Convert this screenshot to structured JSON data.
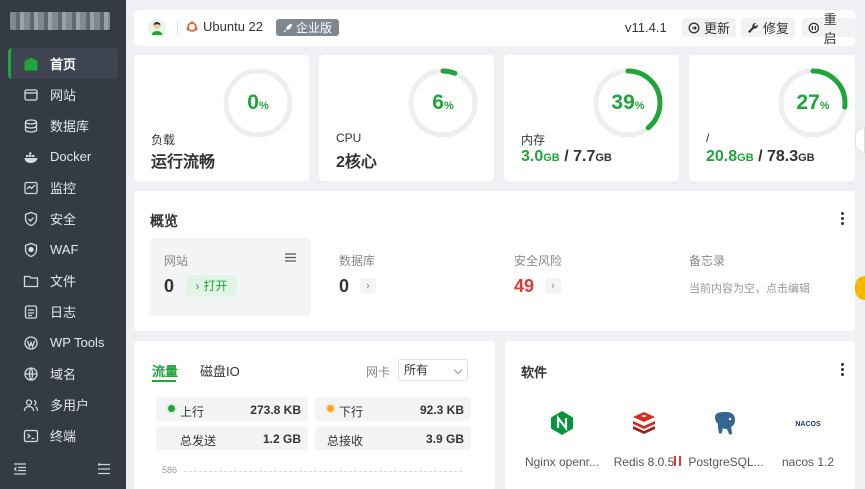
{
  "sidebar": {
    "items": [
      {
        "label": "首页",
        "icon": "home-icon",
        "active": true
      },
      {
        "label": "网站",
        "icon": "globe-icon"
      },
      {
        "label": "数据库",
        "icon": "database-icon"
      },
      {
        "label": "Docker",
        "icon": "docker-icon"
      },
      {
        "label": "监控",
        "icon": "monitor-icon"
      },
      {
        "label": "安全",
        "icon": "shield-icon"
      },
      {
        "label": "WAF",
        "icon": "waf-shield-icon"
      },
      {
        "label": "文件",
        "icon": "folder-icon"
      },
      {
        "label": "日志",
        "icon": "log-icon"
      },
      {
        "label": "WP Tools",
        "icon": "wordpress-icon"
      },
      {
        "label": "域名",
        "icon": "domain-icon"
      },
      {
        "label": "多用户",
        "icon": "users-icon"
      },
      {
        "label": "终端",
        "icon": "terminal-icon"
      }
    ]
  },
  "topbar": {
    "os": "Ubuntu 22",
    "edition": "企业版",
    "version": "v11.4.1",
    "update_label": "更新",
    "repair_label": "修复",
    "restart_label": "重启"
  },
  "stats": {
    "load": {
      "percent": 0,
      "label": "负载",
      "value": "运行流畅"
    },
    "cpu": {
      "percent": 6,
      "label": "CPU",
      "value": "2核心"
    },
    "memory": {
      "percent": 39,
      "label": "内存",
      "used": "3.0",
      "total": "7.7",
      "unit": "GB"
    },
    "disk": {
      "percent": 27,
      "label": "/",
      "used": "20.8",
      "total": "78.3",
      "unit": "GB"
    },
    "percent_sign": "%",
    "slash": " / "
  },
  "overview": {
    "title": "概览",
    "site_label": "网站",
    "site_count": "0",
    "open_label": "打开",
    "db_label": "数据库",
    "db_count": "0",
    "risk_label": "安全风险",
    "risk_count": "49",
    "memo_label": "备忘录",
    "memo_empty": "当前内容为空，点击编辑"
  },
  "traffic": {
    "tab_flow": "流量",
    "tab_disk": "磁盘IO",
    "nic_label": "网卡",
    "nic_value": "所有",
    "up_label": "上行",
    "up_value": "273.8 KB",
    "down_label": "下行",
    "down_value": "92.3 KB",
    "total_sent_label": "总发送",
    "total_sent_value": "1.2 GB",
    "total_recv_label": "总接收",
    "total_recv_value": "3.9 GB",
    "axis_label": "586",
    "colors": {
      "up": "#20a53a",
      "down": "#f5a623"
    }
  },
  "software": {
    "title": "软件",
    "items": [
      {
        "name": "Nginx openr...",
        "icon": "nginx-icon"
      },
      {
        "name": "Redis 8.0.5",
        "icon": "redis-icon"
      },
      {
        "name": "PostgreSQL...",
        "icon": "postgresql-icon"
      },
      {
        "name": "nacos 1.2",
        "icon": "nacos-icon",
        "logo_text": "NACOS"
      }
    ]
  },
  "colors": {
    "accent": "#20a53a",
    "danger": "#e53935",
    "sidebar": "#353b45"
  }
}
